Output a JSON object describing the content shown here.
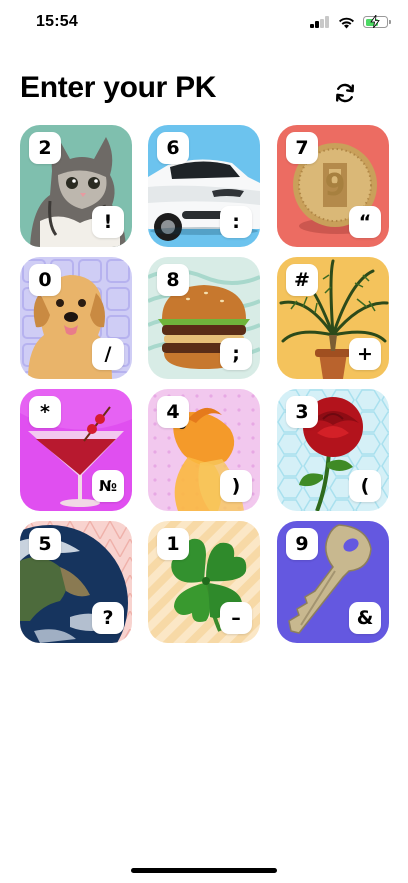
{
  "status_bar": {
    "time": "15:54",
    "icons": [
      "cellular-signal-icon",
      "wifi-icon",
      "battery-charging-icon"
    ],
    "battery_color": "#4cd964"
  },
  "header": {
    "title": "Enter your PK",
    "refresh_icon": "refresh-icon"
  },
  "keys": [
    {
      "image": "kitten",
      "digit": "2",
      "symbol": "!",
      "bg": "#7fbfae"
    },
    {
      "image": "car",
      "digit": "6",
      "symbol": ":",
      "bg": "#6cc3ee"
    },
    {
      "image": "coin",
      "digit": "7",
      "symbol": "“",
      "bg": "#ec6c62"
    },
    {
      "image": "puppy",
      "digit": "0",
      "symbol": "/",
      "bg": "#cfcdf5"
    },
    {
      "image": "burger",
      "digit": "8",
      "symbol": ";",
      "bg": "#d8ece6"
    },
    {
      "image": "palm-tree",
      "digit": "#",
      "symbol": "+",
      "bg": "#f4c35c"
    },
    {
      "image": "cocktail",
      "digit": "*",
      "symbol": "№",
      "bg": "#e04ff0"
    },
    {
      "image": "goldfish",
      "digit": "4",
      "symbol": ")",
      "bg": "#f2c8ee"
    },
    {
      "image": "rose",
      "digit": "3",
      "symbol": "(",
      "bg": "#d5f0f7"
    },
    {
      "image": "earth",
      "digit": "5",
      "symbol": "?",
      "bg": "#f8d3cf"
    },
    {
      "image": "clover",
      "digit": "1",
      "symbol": "–",
      "bg": "#fbe7c6"
    },
    {
      "image": "key",
      "digit": "9",
      "symbol": "&",
      "bg": "#6458e0"
    }
  ]
}
